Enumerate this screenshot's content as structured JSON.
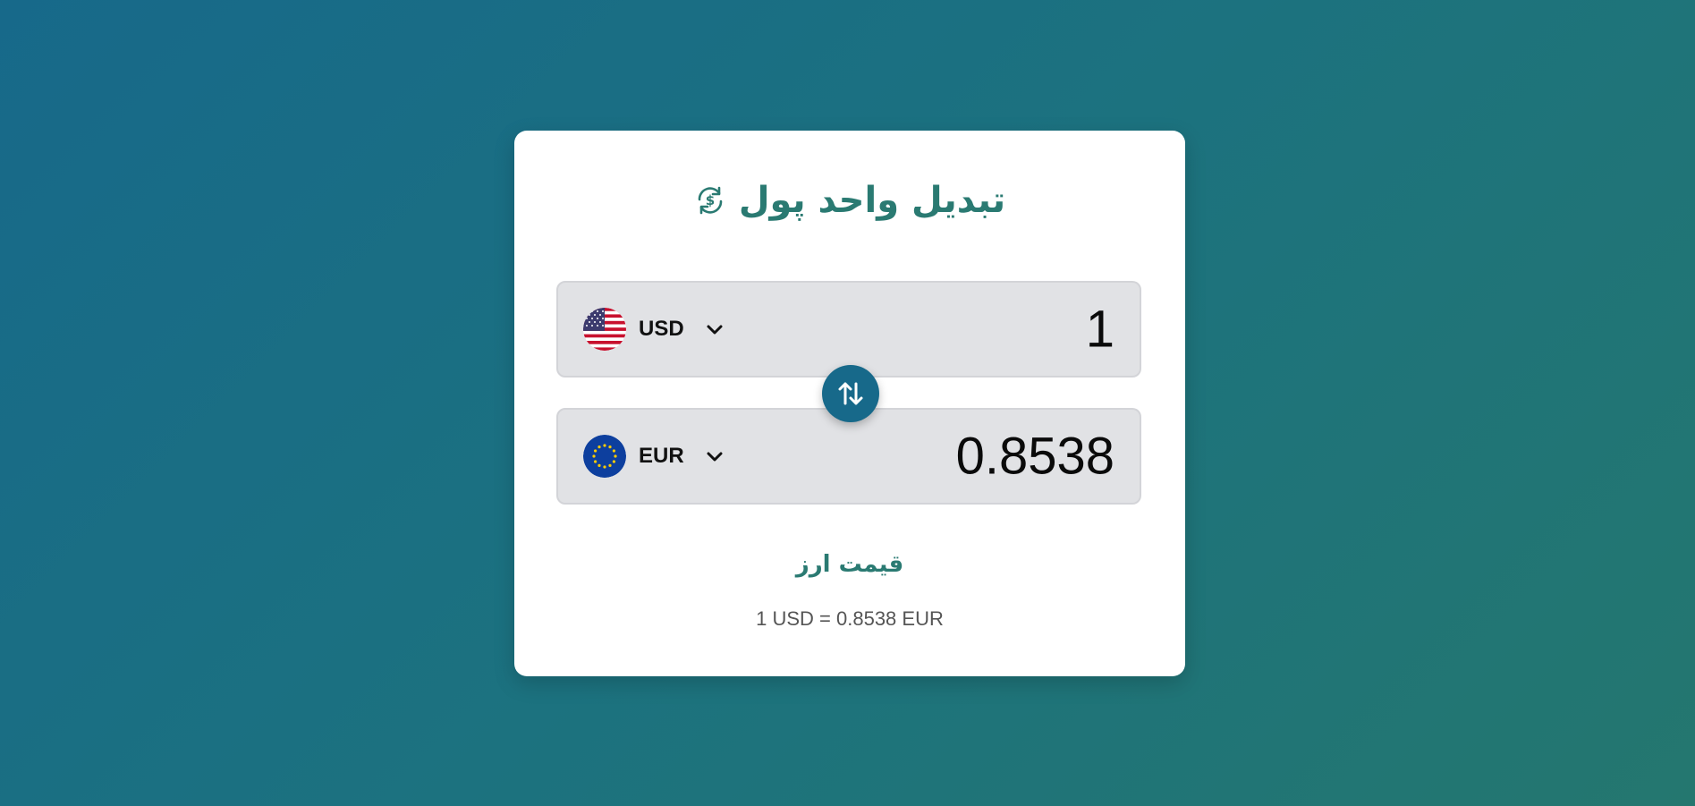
{
  "app": {
    "title": "تبدیل واحد پول",
    "title_icon": "currency-exchange-icon"
  },
  "from": {
    "currency_code": "USD",
    "flag": "us-flag-icon",
    "amount": "1"
  },
  "to": {
    "currency_code": "EUR",
    "flag": "eu-flag-icon",
    "amount": "0.8538"
  },
  "swap": {
    "icon": "swap-arrows-icon"
  },
  "rate": {
    "label": "قیمت ارز",
    "text": "1 USD = 0.8538 EUR"
  },
  "colors": {
    "accent": "#2a7a72",
    "swap_button": "#17698a",
    "field_bg": "#e1e2e5"
  }
}
